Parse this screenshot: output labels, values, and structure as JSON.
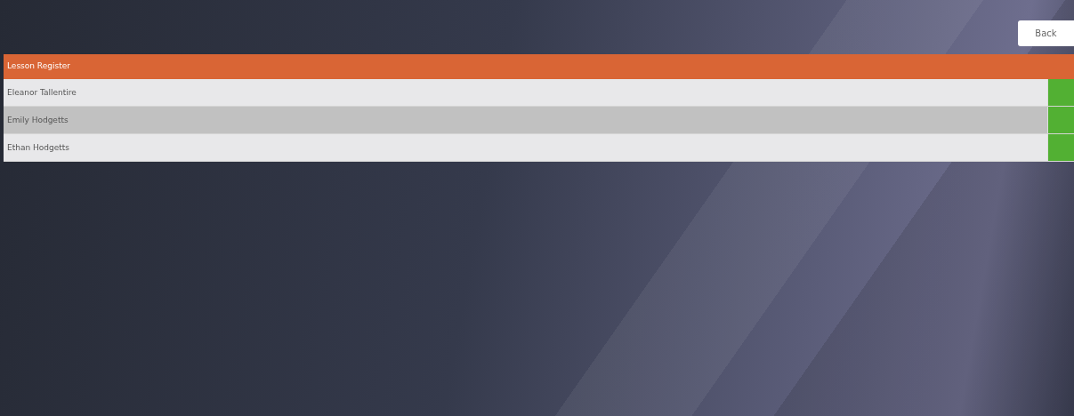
{
  "back_button": {
    "label": "Back"
  },
  "register": {
    "title": "Lesson Register",
    "rows": [
      {
        "name": "Eleanor Tallentire",
        "selected": false,
        "present": true
      },
      {
        "name": "Emily Hodgetts",
        "selected": true,
        "present": true
      },
      {
        "name": "Ethan Hodgetts",
        "selected": false,
        "present": true
      }
    ]
  }
}
